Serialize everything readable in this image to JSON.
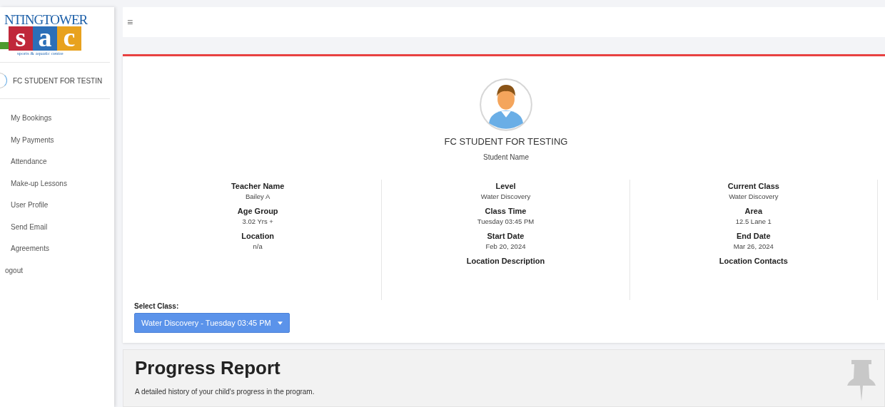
{
  "logo": {
    "top": "NTINGTOWER",
    "letters": [
      {
        "char": "s",
        "color": "#c0283a"
      },
      {
        "char": "a",
        "color": "#2c6fb8"
      },
      {
        "char": "c",
        "color": "#e8a21e"
      }
    ],
    "tagline": "sports & aquatic centre"
  },
  "sidebar": {
    "user": "FC STUDENT FOR TESTIN",
    "items": [
      {
        "label": "My Bookings"
      },
      {
        "label": "My Payments"
      },
      {
        "label": "Attendance"
      },
      {
        "label": "Make-up Lessons"
      },
      {
        "label": "User Profile"
      },
      {
        "label": "Send Email"
      },
      {
        "label": "Agreements"
      },
      {
        "label": "ogout"
      }
    ]
  },
  "topbar": {
    "menu_icon": "≡"
  },
  "profile": {
    "name": "FC STUDENT FOR TESTING",
    "caption": "Student Name"
  },
  "details": [
    [
      {
        "label": "Teacher Name",
        "value": "Bailey A"
      },
      {
        "label": "Age Group",
        "value": "3.02 Yrs +"
      },
      {
        "label": "Location",
        "value": "n/a"
      }
    ],
    [
      {
        "label": "Level",
        "value": "Water Discovery"
      },
      {
        "label": "Class Time",
        "value": "Tuesday 03:45 PM"
      },
      {
        "label": "Start Date",
        "value": "Feb 20, 2024"
      },
      {
        "label": "Location Description"
      }
    ],
    [
      {
        "label": "Current Class",
        "value": "Water Discovery"
      },
      {
        "label": "Area",
        "value": "12.5 Lane 1"
      },
      {
        "label": "End Date",
        "value": "Mar 26, 2024"
      },
      {
        "label": "Location Contacts"
      }
    ]
  ],
  "select_class": {
    "label": "Select Class:",
    "value": "Water Discovery - Tuesday 03:45 PM"
  },
  "progress_report": {
    "title": "Progress Report",
    "description": "A detailed history of your child's progress in the program."
  }
}
